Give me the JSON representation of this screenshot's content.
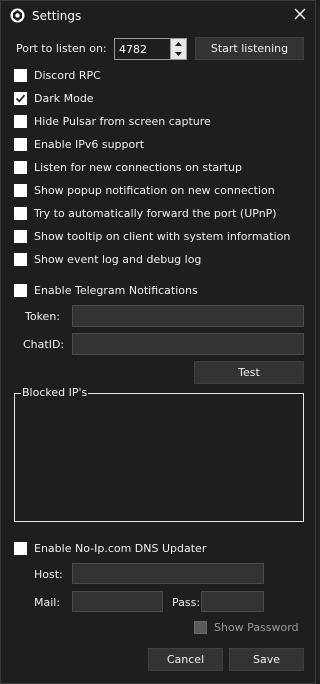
{
  "window": {
    "title": "Settings"
  },
  "port": {
    "label": "Port to listen on:",
    "value": "4782",
    "start_button": "Start listening"
  },
  "options": [
    {
      "label": "Discord RPC",
      "checked": false
    },
    {
      "label": "Dark Mode",
      "checked": true
    },
    {
      "label": "Hide Pulsar from screen capture",
      "checked": false
    },
    {
      "label": "Enable IPv6 support",
      "checked": false
    },
    {
      "label": "Listen for new connections on startup",
      "checked": false
    },
    {
      "label": "Show popup notification on new connection",
      "checked": false
    },
    {
      "label": "Try to automatically forward the port (UPnP)",
      "checked": false
    },
    {
      "label": "Show tooltip on client with system information",
      "checked": false
    },
    {
      "label": "Show event log and debug log",
      "checked": false
    }
  ],
  "telegram": {
    "enable_label": "Enable Telegram Notifications",
    "token_label": "Token:",
    "token_value": "",
    "chatid_label": "ChatID:",
    "chatid_value": "",
    "test_button": "Test"
  },
  "blocked": {
    "group_label": "Blocked IP's",
    "content": ""
  },
  "noip": {
    "enable_label": "Enable No-Ip.com DNS Updater",
    "host_label": "Host:",
    "host_value": "",
    "mail_label": "Mail:",
    "mail_value": "",
    "pass_label": "Pass:",
    "pass_value": "",
    "show_password_label": "Show Password"
  },
  "footer": {
    "cancel_button": "Cancel",
    "save_button": "Save"
  },
  "colors": {
    "background": "#1e1e1e",
    "field": "#333333",
    "text": "#f0f0f0",
    "disabled_text": "#9a9a9a"
  },
  "icons": [
    "pulsar-logo-icon",
    "close-icon",
    "spin-up-icon",
    "spin-down-icon",
    "checkmark-icon"
  ]
}
